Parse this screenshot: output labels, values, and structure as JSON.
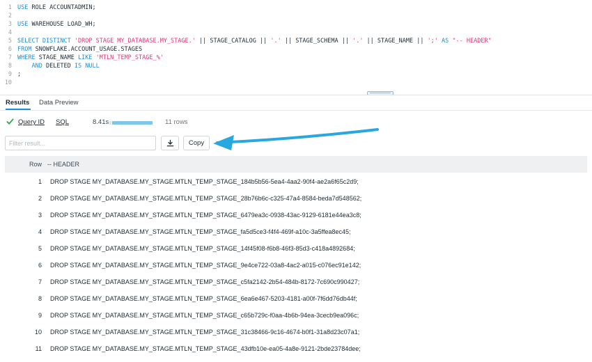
{
  "editor": {
    "lines": [
      {
        "n": "1",
        "segs": [
          [
            "kw",
            "USE"
          ],
          [
            "pl",
            " ROLE ACCOUNTADMIN;"
          ]
        ]
      },
      {
        "n": "2",
        "segs": []
      },
      {
        "n": "3",
        "segs": [
          [
            "kw",
            "USE"
          ],
          [
            "pl",
            " WAREHOUSE LOAD_WH;"
          ]
        ]
      },
      {
        "n": "4",
        "segs": []
      },
      {
        "n": "5",
        "segs": [
          [
            "kw",
            "SELECT DISTINCT"
          ],
          [
            "pl",
            " "
          ],
          [
            "str",
            "'DROP STAGE MY_DATABASE.MY_STAGE.'"
          ],
          [
            "pl",
            " || STAGE_CATALOG || "
          ],
          [
            "str",
            "'.'"
          ],
          [
            "pl",
            " || STAGE_SCHEMA || "
          ],
          [
            "str",
            "'.'"
          ],
          [
            "pl",
            " || STAGE_NAME || "
          ],
          [
            "str",
            "';'"
          ],
          [
            "pl",
            " "
          ],
          [
            "kw",
            "AS"
          ],
          [
            "pl",
            " "
          ],
          [
            "str",
            "\"-- HEADER\""
          ]
        ]
      },
      {
        "n": "6",
        "segs": [
          [
            "kw",
            "FROM"
          ],
          [
            "pl",
            " SNOWFLAKE.ACCOUNT_USAGE.STAGES"
          ]
        ]
      },
      {
        "n": "7",
        "segs": [
          [
            "kw",
            "WHERE"
          ],
          [
            "pl",
            " STAGE_NAME "
          ],
          [
            "kw",
            "LIKE"
          ],
          [
            "pl",
            " "
          ],
          [
            "str",
            "'MTLN_TEMP_STAGE_%'"
          ]
        ]
      },
      {
        "n": "8",
        "segs": [
          [
            "pl",
            "    "
          ],
          [
            "kw",
            "AND"
          ],
          [
            "pl",
            " DELETED "
          ],
          [
            "kw",
            "IS NULL"
          ]
        ]
      },
      {
        "n": "9",
        "segs": [
          [
            "pl",
            ";"
          ]
        ]
      },
      {
        "n": "10",
        "segs": []
      }
    ]
  },
  "tabs": {
    "results": "Results",
    "preview": "Data Preview"
  },
  "status": {
    "query_id": "Query ID",
    "sql": "SQL",
    "duration": "8.41s",
    "rows": "11 rows",
    "success_color": "#2ea84f"
  },
  "toolbar": {
    "filter_placeholder": "Filter result...",
    "download_icon": "download-icon",
    "copy_label": "Copy"
  },
  "annotation": {
    "arrow_color": "#29a8e0"
  },
  "table": {
    "headers": {
      "row": "Row",
      "col": "-- HEADER"
    },
    "rows": [
      {
        "n": "1",
        "v": "DROP STAGE MY_DATABASE.MY_STAGE.MTLN_TEMP_STAGE_184b5b56-5ea4-4aa2-90f4-ae2a6f65c2d9;"
      },
      {
        "n": "2",
        "v": "DROP STAGE MY_DATABASE.MY_STAGE.MTLN_TEMP_STAGE_28b76b6c-c325-47a4-8584-beda7d548562;"
      },
      {
        "n": "3",
        "v": "DROP STAGE MY_DATABASE.MY_STAGE.MTLN_TEMP_STAGE_6479ea3c-0938-43ac-9129-6181e44ea3c8;"
      },
      {
        "n": "4",
        "v": "DROP STAGE MY_DATABASE.MY_STAGE.MTLN_TEMP_STAGE_fa5d5ce3-f4f4-469f-a10c-3a5ffea8ec45;"
      },
      {
        "n": "5",
        "v": "DROP STAGE MY_DATABASE.MY_STAGE.MTLN_TEMP_STAGE_14f45f08-f6b8-46f3-85d3-c418a4892684;"
      },
      {
        "n": "6",
        "v": "DROP STAGE MY_DATABASE.MY_STAGE.MTLN_TEMP_STAGE_9e4ce722-03a8-4ac2-a015-c076ec91e142;"
      },
      {
        "n": "7",
        "v": "DROP STAGE MY_DATABASE.MY_STAGE.MTLN_TEMP_STAGE_c5fa2142-2b54-484b-8172-7c690c990427;"
      },
      {
        "n": "8",
        "v": "DROP STAGE MY_DATABASE.MY_STAGE.MTLN_TEMP_STAGE_6ea6e467-5203-4181-a00f-7f6dd76db44f;"
      },
      {
        "n": "9",
        "v": "DROP STAGE MY_DATABASE.MY_STAGE.MTLN_TEMP_STAGE_c65b729c-f0aa-4b6b-94ea-3cecb9ea096c;"
      },
      {
        "n": "10",
        "v": "DROP STAGE MY_DATABASE.MY_STAGE.MTLN_TEMP_STAGE_31c38466-9c16-4674-b0f1-31a8d23c07a1;"
      },
      {
        "n": "11",
        "v": "DROP STAGE MY_DATABASE.MY_STAGE.MTLN_TEMP_STAGE_43dfb10e-ea05-4a8e-9121-2bde23784dee;"
      }
    ]
  }
}
